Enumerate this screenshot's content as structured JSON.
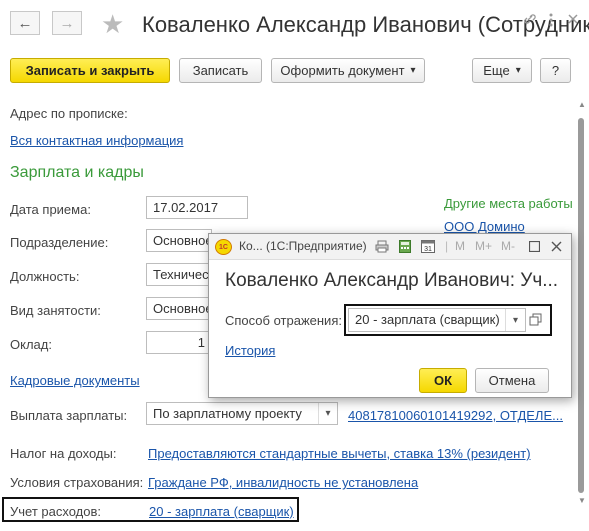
{
  "window": {
    "title": "Коваленко Александр Иванович (Сотрудник)",
    "link_icon": "link-icon",
    "more_icon": "more-vertical-icon",
    "close_icon": "close-icon",
    "back_glyph": "←",
    "forward_glyph": "→",
    "star_glyph": "★"
  },
  "toolbar": {
    "save_close": "Записать и закрыть",
    "save": "Записать",
    "make_document": "Оформить документ",
    "more": "Еще",
    "help": "?",
    "dropdown_glyph": "▾"
  },
  "form": {
    "address_label": "Адрес по прописке:",
    "contact_link": "Вся контактная информация",
    "section_title": "Зарплата и кадры",
    "hire_date_label": "Дата приема:",
    "hire_date": "17.02.2017",
    "department_label": "Подразделение:",
    "department": "Основное",
    "position_label": "Должность:",
    "position": "Технически",
    "employment_label": "Вид занятости:",
    "employment": "Основное",
    "salary_label": "Оклад:",
    "salary": "1",
    "hr_docs_link": "Кадровые документы",
    "other_places": "Другие места работы",
    "company_link": "ООО Домино",
    "payout_label": "Выплата зарплаты:",
    "payout": "По зарплатному проекту",
    "account_link": "40817810060101419292, ОТДЕЛЕ...",
    "tax_label": "Налог на доходы:",
    "tax_link": "Предоставляются стандартные вычеты, ставка 13% (резидент)",
    "insurance_label": "Условия страхования:",
    "insurance_link": "Граждане РФ, инвалидность не установлена",
    "expenses_label": "Учет расходов:",
    "expenses_link": "20 - зарплата (сварщик)"
  },
  "dialog": {
    "app_icon_text": "1С",
    "header_title": "Ко... (1С:Предприятие)",
    "m_glyph": "M",
    "mplus_glyph": "M+",
    "mminus_glyph": "M-",
    "title": "Коваленко Александр Иванович: Уч...",
    "method_label": "Способ отражения:",
    "method_value": "20 - зарплата (сварщик)",
    "history_link": "История",
    "ok": "ОК",
    "cancel": "Отмена"
  },
  "colors": {
    "primary_button": "#f5d800",
    "link": "#1a55aa",
    "section": "#3a9a3a",
    "highlight_frame": "#111111"
  }
}
